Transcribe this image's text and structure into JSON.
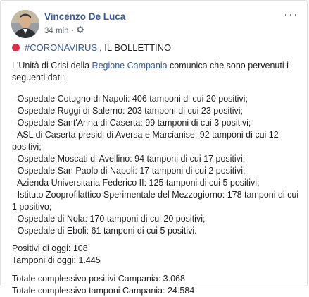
{
  "post": {
    "author": "Vincenzo De Luca",
    "time": "34 min",
    "meta_separator": "·",
    "more_glyph": "···",
    "headline_hashtag": "#CORONAVIRUS",
    "headline_rest": ", IL BOLLETTINO",
    "intro_before": "L'Unità di Crisi della ",
    "intro_link": "Regione Campania",
    "intro_after": " comunica che sono pervenuti i seguenti dati:",
    "items": [
      "- Ospedale Cotugno di Napoli: 406 tamponi di cui 20 positivi;",
      "- Ospedale Ruggi di Salerno: 203 tamponi di cui 23 positivi;",
      "- Ospedale Sant'Anna di Caserta: 99 tamponi di cui 3 positivi;",
      "- ASL di Caserta presidi di Aversa e Marcianise: 92 tamponi di cui 12 positivi;",
      "- Ospedale Moscati di Avellino: 94 tamponi di cui 17 positivi;",
      "- Ospedale San Paolo di Napoli: 17 tamponi di cui 2 positivi;",
      "- Azienda Universitaria Federico II: 125 tamponi di cui 5 positivi;",
      "- Istituto Zooprofilattico Sperimentale del Mezzogiorno: 178 tamponi di cui 1 positivo;",
      "- Ospedale di Nola: 170 tamponi di cui 20 positivi;",
      "- Ospedale di Eboli: 61 tamponi di cui 5 positivi."
    ],
    "positivi_oggi": "Positivi di oggi: 108",
    "tamponi_oggi": "Tamponi di oggi: 1.445",
    "totale_positivi": "Totale complessivo positivi Campania: 3.068",
    "totale_tamponi": "Totale complessivo tamponi Campania: 24.584"
  },
  "colors": {
    "link": "#385898",
    "text": "#1c1e21",
    "meta": "#616770",
    "red": "#dd2e44"
  },
  "icons": {
    "visibility": "gear-icon",
    "headline": "red-circle-icon"
  }
}
